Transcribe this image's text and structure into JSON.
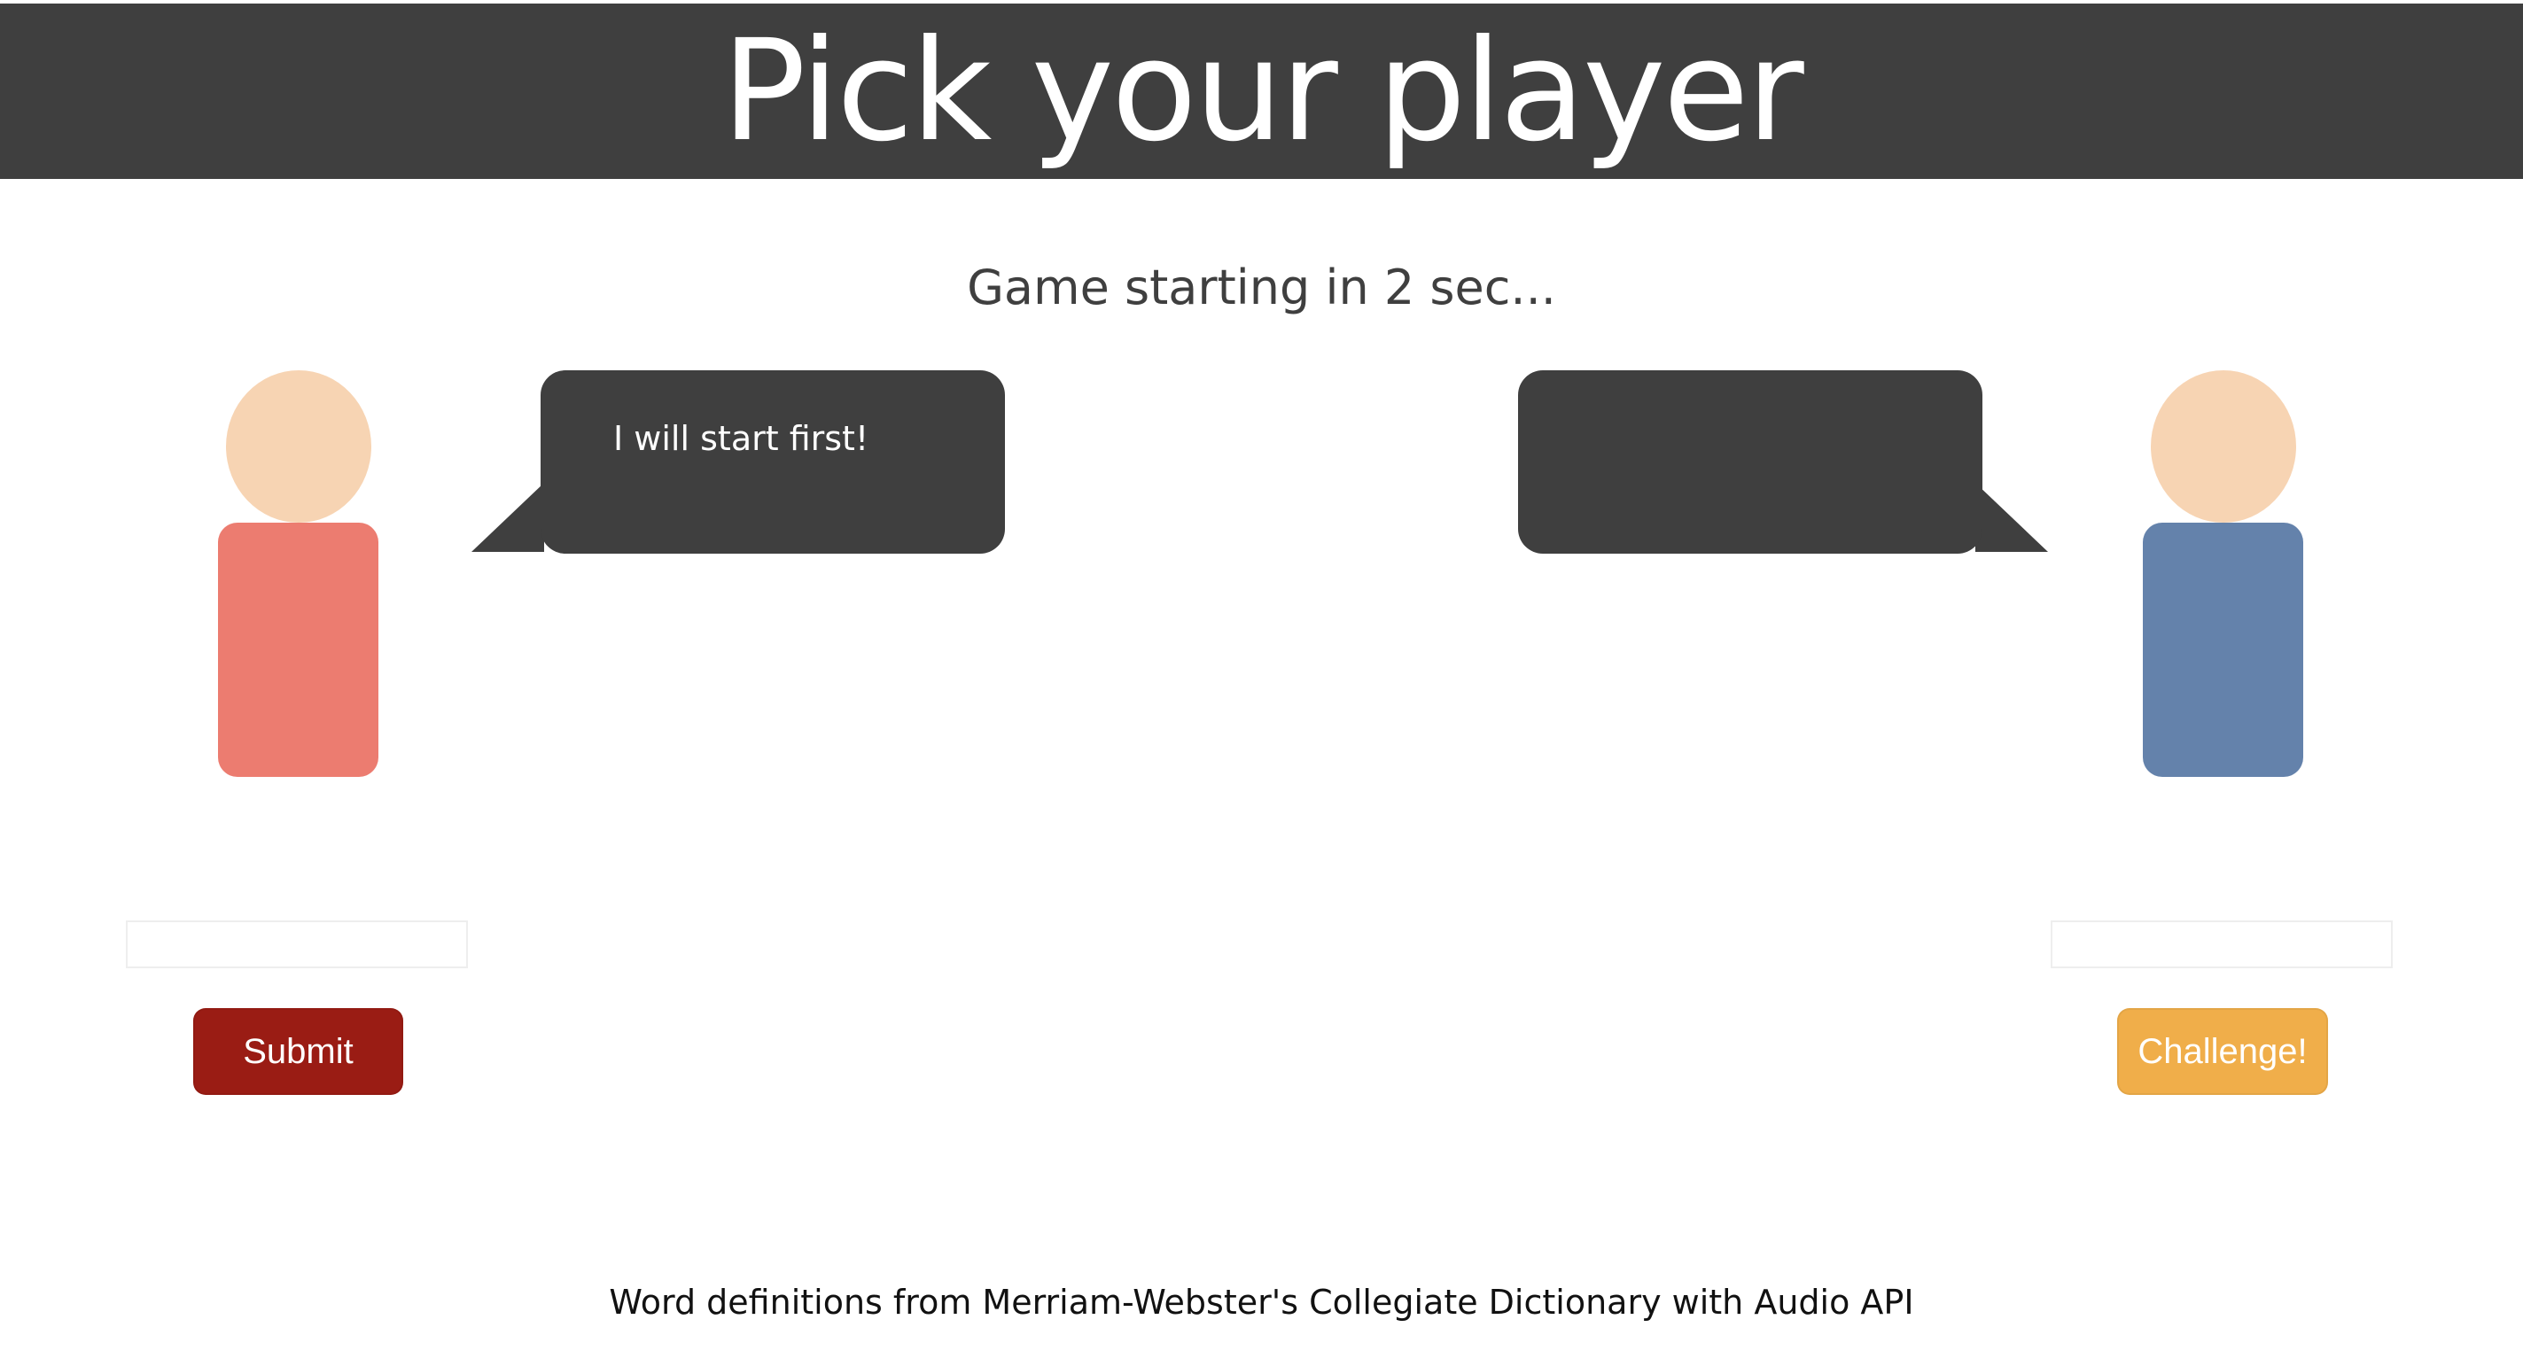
{
  "header": {
    "title": "Pick your player"
  },
  "status": {
    "text": "Game starting in 2 sec..."
  },
  "players": {
    "left": {
      "speech": "I will start first!",
      "input_value": "",
      "button_label": "Submit",
      "button_color": "#9a1c14",
      "body_color": "#ec7c70"
    },
    "right": {
      "speech": "",
      "input_value": "",
      "button_label": "Challenge!",
      "button_color": "#f0ae4a",
      "body_color": "#6482ab"
    },
    "head_color": "#f7d4b3"
  },
  "footer": {
    "credit": "Word definitions from Merriam-Webster's Collegiate Dictionary with Audio API"
  },
  "colors": {
    "header_bg": "#3f3f3f",
    "bubble_bg": "#3f3f3f"
  }
}
